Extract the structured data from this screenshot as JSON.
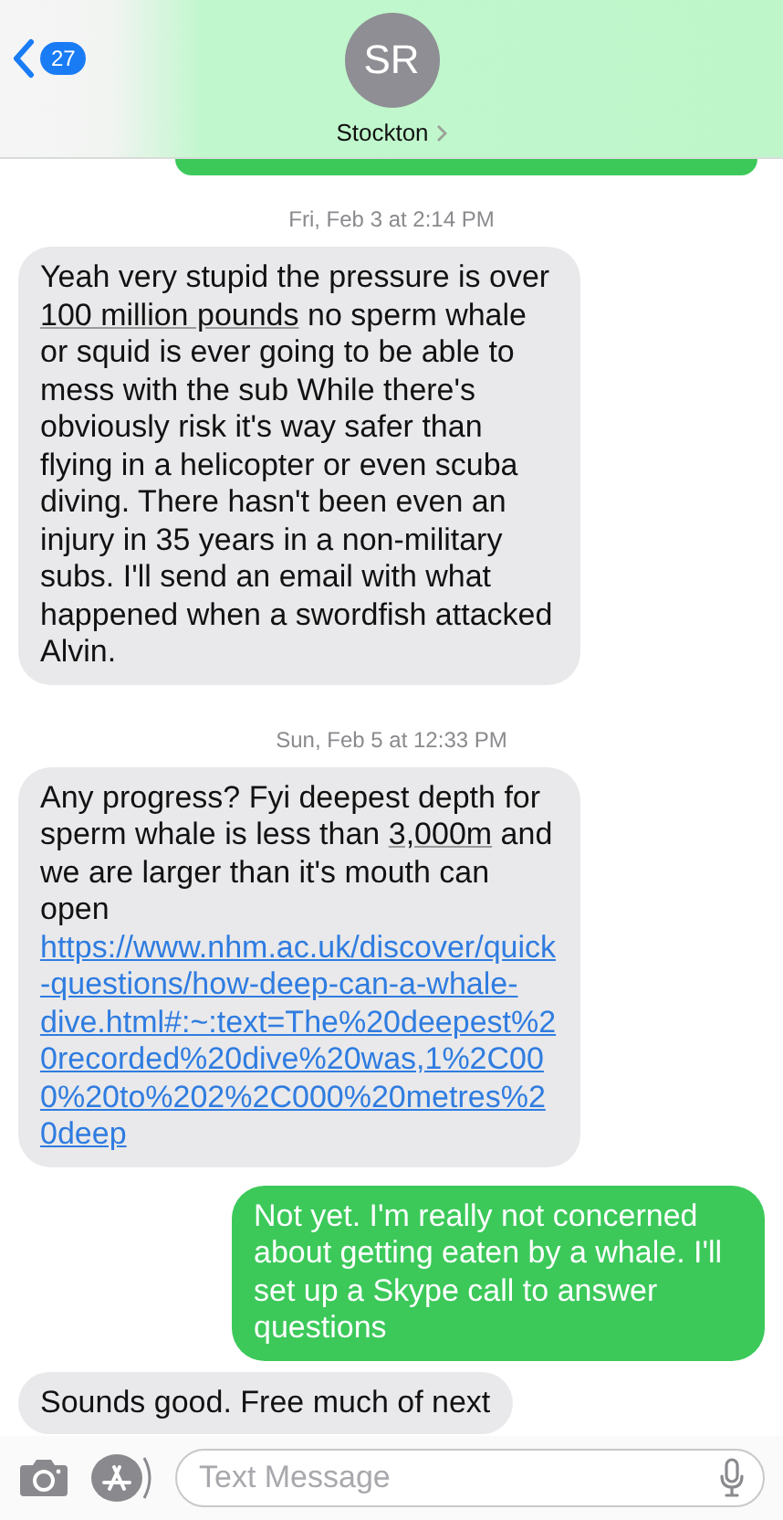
{
  "header": {
    "back_count": "27",
    "avatar_initials": "SR",
    "contact_name": "Stockton"
  },
  "messages": [
    {
      "kind": "sent_partial"
    },
    {
      "kind": "timestamp",
      "text": "Fri, Feb 3 at 2:14 PM"
    },
    {
      "kind": "received",
      "segments": [
        {
          "kind": "plain",
          "text": "Yeah very stupid the pressure is over "
        },
        {
          "kind": "detected",
          "text": "100 million pounds"
        },
        {
          "kind": "plain",
          "text": " no sperm whale or squid is ever going to be able to mess with the sub While there's obviously risk it's way safer than flying in a helicopter or even scuba diving. There hasn't been even an injury in 35 years in a non-military subs. I'll send an email with what happened when a swordfish attacked Alvin."
        }
      ]
    },
    {
      "kind": "timestamp",
      "text": "Sun, Feb 5 at 12:33 PM"
    },
    {
      "kind": "received",
      "segments": [
        {
          "kind": "plain",
          "text": "Any progress?  Fyi deepest depth for sperm whale is less than "
        },
        {
          "kind": "detected",
          "text": "3,000m"
        },
        {
          "kind": "plain",
          "text": " and we are larger than it's mouth can open "
        },
        {
          "kind": "link",
          "text": "https://www.nhm.ac.uk/discover/quick-questions/how-deep-can-a-whale-dive.html#:~:text=The%20deepest%20recorded%20dive%20was,1%2C000%20to%202%2C000%20metres%20deep"
        }
      ]
    },
    {
      "kind": "sent",
      "segments": [
        {
          "kind": "plain",
          "text": "Not yet.  I'm really not concerned about getting eaten by a whale. I'll set up a Skype call to answer questions"
        }
      ]
    },
    {
      "kind": "received",
      "segments": [
        {
          "kind": "plain",
          "text": "Sounds good. Free much of next"
        }
      ]
    }
  ],
  "composer": {
    "placeholder": "Text Message"
  }
}
